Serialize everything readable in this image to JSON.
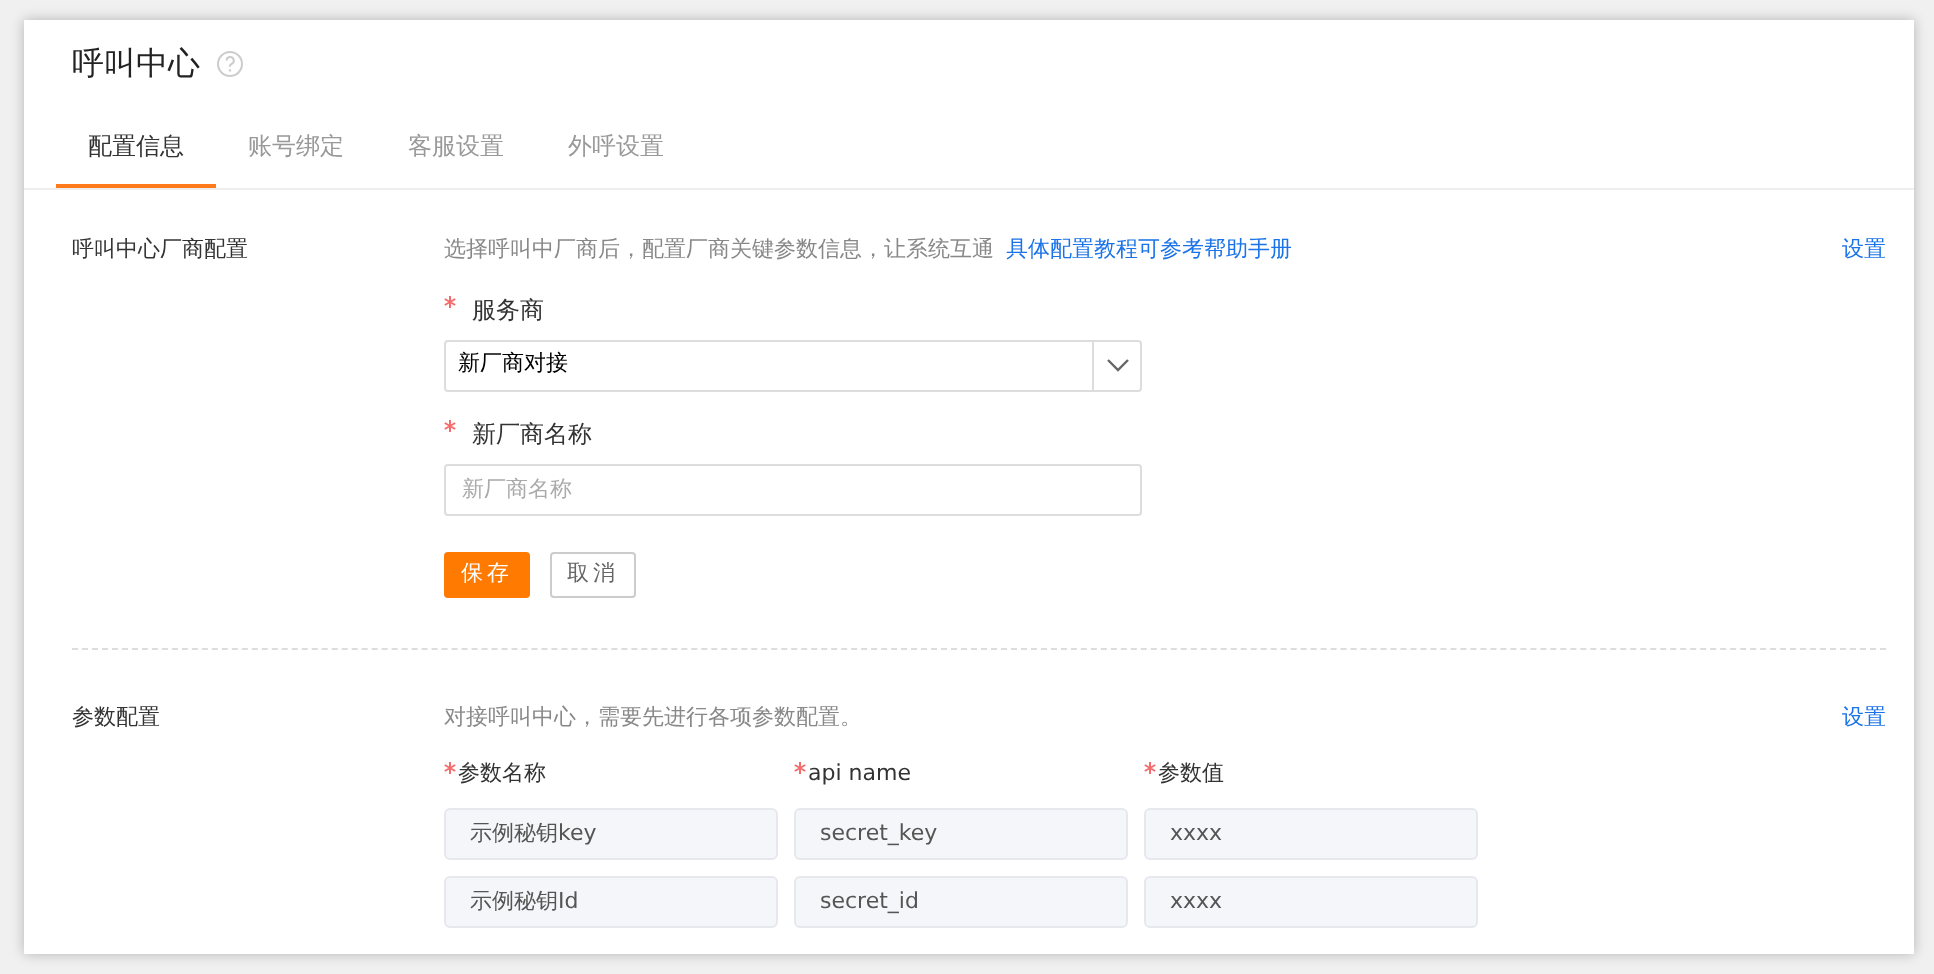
{
  "header": {
    "title": "呼叫中心"
  },
  "tabs": [
    {
      "label": "配置信息",
      "selected": true
    },
    {
      "label": "账号绑定",
      "selected": false
    },
    {
      "label": "客服设置",
      "selected": false
    },
    {
      "label": "外呼设置",
      "selected": false
    }
  ],
  "vendor_config": {
    "label": "呼叫中心厂商配置",
    "action": "设置",
    "hint": "选择呼叫中厂商后，配置厂商关键参数信息，让系统互通",
    "help_link": "具体配置教程可参考帮助手册",
    "fields": [
      {
        "kind": "select",
        "required": true,
        "label": "服务商",
        "value": "新厂商对接"
      },
      {
        "kind": "input",
        "required": true,
        "label": "新厂商名称",
        "placeholder": "新厂商名称"
      }
    ],
    "buttons": [
      {
        "kind": "primary",
        "label": "保存"
      },
      {
        "kind": "default",
        "label": "取消"
      }
    ]
  },
  "param_config": {
    "label": "参数配置",
    "action": "设置",
    "hint": "对接呼叫中心，需要先进行各项参数配置。",
    "columns": [
      {
        "label": "参数名称",
        "required": true
      },
      {
        "label": "api name",
        "required": true
      },
      {
        "label": "参数值",
        "required": true
      }
    ],
    "rows": [
      [
        "示例秘钥key",
        "secret_key",
        "xxxx"
      ],
      [
        "示例秘钥Id",
        "secret_id",
        "xxxx"
      ]
    ]
  }
}
